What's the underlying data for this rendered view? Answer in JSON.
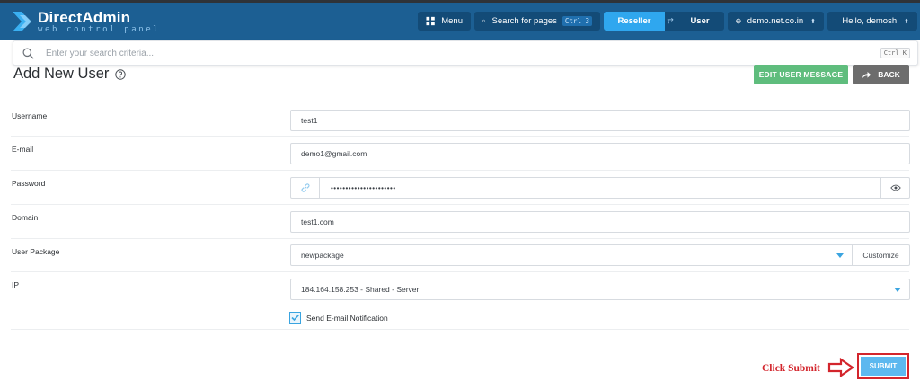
{
  "app": {
    "logo_title": "DirectAdmin",
    "logo_subtitle": "web control panel"
  },
  "header": {
    "menu_label": "Menu",
    "search_label": "Search for pages",
    "search_shortcut": "Ctrl 3",
    "role_reseller": "Reseller",
    "role_user": "User",
    "domain_select": "demo.net.co.in",
    "greeting": "Hello, demosh"
  },
  "search": {
    "placeholder": "Enter your search criteria...",
    "shortcut": "Ctrl K"
  },
  "page": {
    "title": "Add New User",
    "edit_message_button": "EDIT USER MESSAGE",
    "back_button": "BACK"
  },
  "form": {
    "username": {
      "label": "Username",
      "value": "test1"
    },
    "email": {
      "label": "E-mail",
      "value": "demo1@gmail.com"
    },
    "password": {
      "label": "Password",
      "value": "••••••••••••••••••••••"
    },
    "domain": {
      "label": "Domain",
      "value": "test1.com"
    },
    "package": {
      "label": "User Package",
      "value": "newpackage",
      "customize": "Customize"
    },
    "ip": {
      "label": "IP",
      "value": "184.164.158.253 - Shared - Server"
    },
    "notification": {
      "label": "Send E-mail Notification",
      "checked": true
    },
    "submit_label": "SUBMIT"
  },
  "annotation": {
    "text": "Click Submit",
    "color": "#d3252c"
  },
  "colors": {
    "header_bg": "#1c5f93",
    "accent": "#2fa7ef",
    "edit_button": "#5fbd7d",
    "back_button": "#6d6d6d",
    "submit_button": "#5cb8ef"
  }
}
